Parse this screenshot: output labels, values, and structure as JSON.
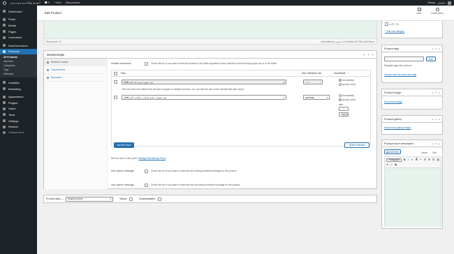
{
  "adminbar": {
    "site_name": "آموزش ووکامرس و وردپرس",
    "comments_count": "0",
    "new_label": "+ New",
    "view_label": "View product",
    "howdy": "Howdy,",
    "user": "سیاوش"
  },
  "sidebar": {
    "items": [
      {
        "label": "Dashboard",
        "icon": "dashboard-icon"
      },
      {
        "label": "Posts",
        "icon": "pin-icon"
      },
      {
        "label": "Media",
        "icon": "media-icon"
      },
      {
        "label": "Pages",
        "icon": "page-icon"
      },
      {
        "label": "Comments",
        "icon": "comment-icon"
      },
      {
        "label": "WooCommerce",
        "icon": "woo-icon"
      },
      {
        "label": "Products",
        "icon": "box-icon"
      }
    ],
    "sub_items": [
      "All Products",
      "Add New",
      "Categories",
      "Tags",
      "Attributes"
    ],
    "items2": [
      {
        "label": "Analytics",
        "icon": "bar-chart-icon"
      },
      {
        "label": "Marketing",
        "icon": "megaphone-icon"
      },
      {
        "label": "Appearance",
        "icon": "brush-icon"
      },
      {
        "label": "Plugins",
        "icon": "plug-icon"
      },
      {
        "label": "Users",
        "icon": "user-icon"
      },
      {
        "label": "Tools",
        "icon": "wrench-icon"
      },
      {
        "label": "Settings",
        "icon": "sliders-icon"
      },
      {
        "label": "Restrict",
        "icon": "lock-icon"
      },
      {
        "label": "Collapse menu",
        "icon": "collapse-icon"
      }
    ]
  },
  "header": {
    "title": "Edit Product",
    "inbox": "Inbox",
    "finish_setup": "Finish setup"
  },
  "status": {
    "word_count": "Word count: 12",
    "last_edited": "Last edited by سیاوش on October 30, 2021 at 8:39 pm"
  },
  "memberships": {
    "title": "Memberships",
    "tabs": [
      "Restrict Content",
      "Grant Access",
      "Discounts"
    ],
    "disable_restrictions_label": "Disable restrictions",
    "disable_restrictions_text": "Check this box if you want to force the product to be public regardless of any restriction rules that may apply now or in the future.",
    "col_plan": "Plan",
    "col_members": "Only members can",
    "col_access": "Accessible",
    "rule1_plan": "پلن عضویت ویژه یک ماهه (#16)",
    "rule1_members": "view",
    "rule1_opt1": "immediately",
    "rule1_opt2": "specify a time",
    "rule1_note": "This rule cannot be edited here because it applies to multiple products. You can edit this rule on the membership plan screen.",
    "rule2_plan": "پلن عضویت، عادی همگی، درگیگی: آنگی (#49)",
    "rule2_members": "purchase",
    "rule2_opt1": "immediately",
    "rule2_opt2": "specify a time",
    "after_label": "after",
    "after_value": "1",
    "after_unit": "day(s)",
    "add_rule": "Add New Rule",
    "delete_selected": "Delete Selected",
    "need_help": "Need to add or edit a plan?",
    "manage_plans": "Manage Membership Plans",
    "custom_msg_label": "Use custom message",
    "custom_msg_text": "Check this box if you want to customize the viewing restricted message for this product.",
    "custom_msg2_label": "Use custom message",
    "custom_msg2_text": "Check this box if you want to customize the purchasing restricted message for this product."
  },
  "product_data": {
    "label": "Product data —",
    "type": "Simple product",
    "virtual": "Virtual:",
    "downloadable": "Downloadable:"
  },
  "right": {
    "top_check": "بلاگ کالایی",
    "add_category": "+ Add new category",
    "tags_title": "Product tags",
    "tags_add": "Add",
    "tags_hint": "Separate tags with commas",
    "tags_choose": "Choose from the most used tags",
    "image_title": "Product image",
    "image_link": "Set product image",
    "gallery_title": "Product gallery",
    "gallery_link": "Add product gallery images",
    "short_title": "Product short description",
    "add_media": "Add Media",
    "visual": "Visual",
    "text": "Text",
    "paragraph": "Paragraph"
  }
}
